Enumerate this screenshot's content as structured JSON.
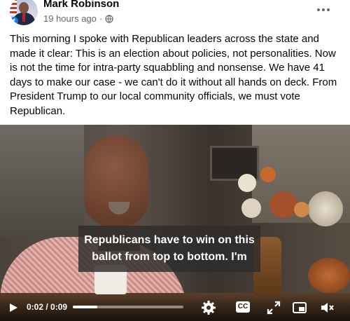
{
  "post": {
    "author": "Mark Robinson",
    "time": "19 hours ago",
    "separator": "·",
    "text": "This morning I spoke with Republican leaders across the state and made it clear: This is an election about policies, not personalities. Now is not the time for intra-party squabbling and nonsense. We have 41 days to make our case - we can't do it without all hands on deck. From President Trump to our local community officials, we must vote Republican.",
    "avatar_badge": "f"
  },
  "video": {
    "caption_line1": "Republicans have to win on this",
    "caption_line2": "ballot from top to bottom. I'm",
    "time_display": "0:02 / 0:09",
    "progress": 0.22,
    "cc_label": "CC"
  },
  "icons": {
    "privacy": "globe-icon",
    "more": "more-options-icon",
    "play": "play-icon",
    "settings": "gear-icon",
    "captions": "closed-captions-icon",
    "fullscreen": "fullscreen-icon",
    "pip": "picture-in-picture-icon",
    "volume": "volume-icon"
  },
  "colors": {
    "brand": "#1877f2",
    "meta_text": "#65676b"
  }
}
